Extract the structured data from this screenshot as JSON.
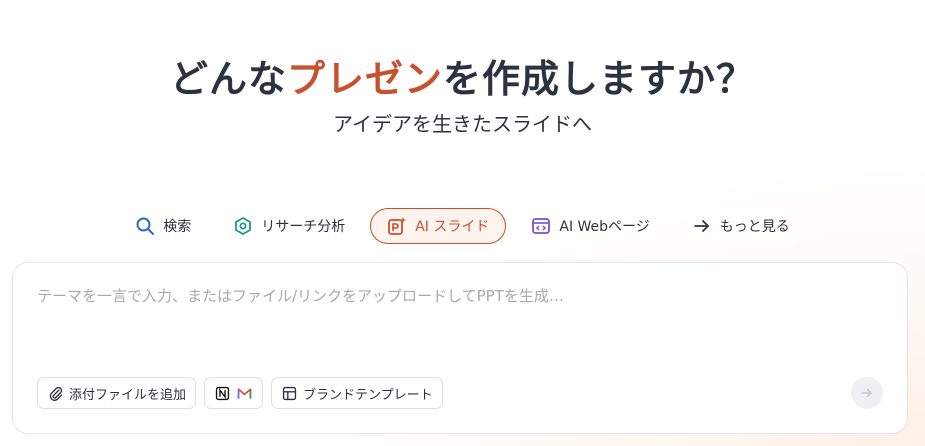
{
  "hero": {
    "title_before": "どんな",
    "title_accent": "プレゼン",
    "title_after": "を作成しますか？",
    "subtitle": "アイデアを生きたスライドへ"
  },
  "tabs": [
    {
      "label": "検索",
      "icon": "search-icon",
      "active": false
    },
    {
      "label": "リサーチ分析",
      "icon": "research-icon",
      "active": false
    },
    {
      "label": "AI スライド",
      "icon": "ai-slide-icon",
      "active": true
    },
    {
      "label": "AI Webページ",
      "icon": "web-page-icon",
      "active": false
    },
    {
      "label": "もっと見る",
      "icon": "arrow-right-icon",
      "active": false
    }
  ],
  "composer": {
    "placeholder": "テーマを一言で入力、またはファイル/リンクをアップロードしてPPTを生成…",
    "attach_label": "添付ファイルを追加",
    "integrations": [
      "notion-icon",
      "gmail-icon"
    ],
    "template_label": "ブランドテンプレート",
    "send_icon": "arrow-right-icon"
  },
  "colors": {
    "accent": "#c8502d",
    "text": "#2b3240",
    "placeholder": "#a6a9b0",
    "gmail_red": "#ea4335"
  }
}
